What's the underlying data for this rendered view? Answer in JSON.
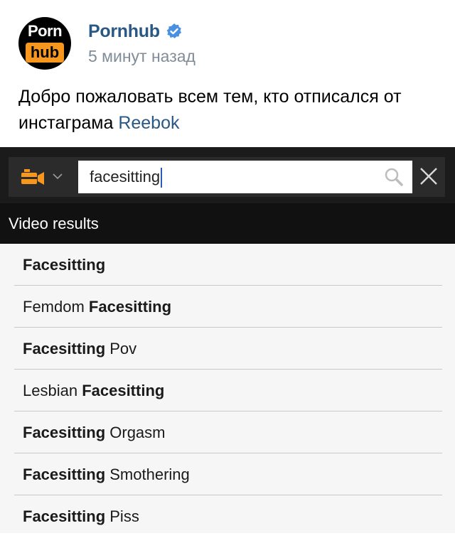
{
  "post": {
    "author": "Pornhub",
    "time": "5 минут назад",
    "avatar_logo": {
      "top": "Porn",
      "bottom": "hub"
    },
    "text": "Добро пожаловать всем тем, кто отписался от инстаграма ",
    "link": "Reebok",
    "colors": {
      "link": "#2a5885",
      "logo_accent": "#f7971d"
    }
  },
  "search": {
    "query": "facesitting",
    "icons": {
      "mode": "video-camera-icon",
      "dropdown": "chevron-down-icon",
      "search": "search-icon",
      "clear": "close-icon"
    }
  },
  "results": {
    "header": "Video results",
    "items": [
      {
        "pre": "",
        "bold": "Facesitting",
        "post": ""
      },
      {
        "pre": "Femdom ",
        "bold": "Facesitting",
        "post": ""
      },
      {
        "pre": "",
        "bold": "Facesitting",
        "post": " Pov"
      },
      {
        "pre": "Lesbian ",
        "bold": "Facesitting",
        "post": ""
      },
      {
        "pre": "",
        "bold": "Facesitting",
        "post": " Orgasm"
      },
      {
        "pre": "",
        "bold": "Facesitting",
        "post": " Smothering"
      },
      {
        "pre": "",
        "bold": "Facesitting",
        "post": " Piss"
      }
    ]
  }
}
